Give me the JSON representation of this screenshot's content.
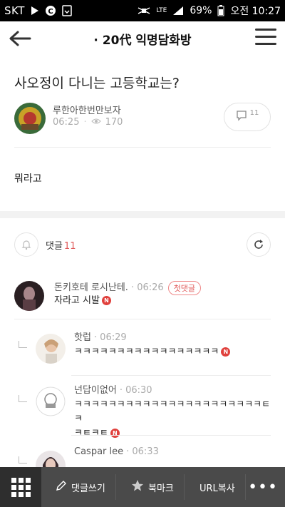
{
  "statusbar": {
    "carrier": "SKT",
    "network": "LTE",
    "battery": "69%",
    "time": "오전 10:27"
  },
  "header": {
    "title": "· 20代 익명담화방"
  },
  "post": {
    "title": "사오정이 다니는 고등학교는?",
    "author": "루한아한번만보자",
    "time": "06:25",
    "views": "170",
    "comment_count": "11",
    "body": "뭐라고"
  },
  "comments_section": {
    "label": "댓글",
    "count": "11"
  },
  "comments": [
    {
      "author": "돈키호테 로시난테.",
      "time": "· 06:26",
      "badge": "첫댓글",
      "text": "자라고 시발",
      "new_badge": "N",
      "reply": false
    },
    {
      "author": "핫럽",
      "time": "· 06:29",
      "text": "ㅋㅋㅋㅋㅋㅋㅋㅋㅋㅋㅋㅋㅋㅋㅋㅋㅋ",
      "new_badge": "N",
      "reply": true
    },
    {
      "author": "넌답이없어",
      "time": "· 06:30",
      "text": "ㅋㅋㅋㅋㅋㅋㅋㅋㅋㅋㅋㅋㅋㅋㅋㅋㅋㅋㅋㅋㅋㅋㅌㅋ",
      "text2": "ㅋㅌㅋㅌ",
      "new_badge": "N",
      "reply": true
    },
    {
      "author": "Caspar lee",
      "time": "· 06:33",
      "reply": true
    }
  ],
  "bottombar": {
    "write": "댓글쓰기",
    "bookmark": "북마크",
    "url_copy": "URL복사",
    "more": "•••"
  },
  "colors": {
    "accent_red": "#e05a5a",
    "badge_red": "#e0403c",
    "bottombar": "#4a4a4a"
  }
}
